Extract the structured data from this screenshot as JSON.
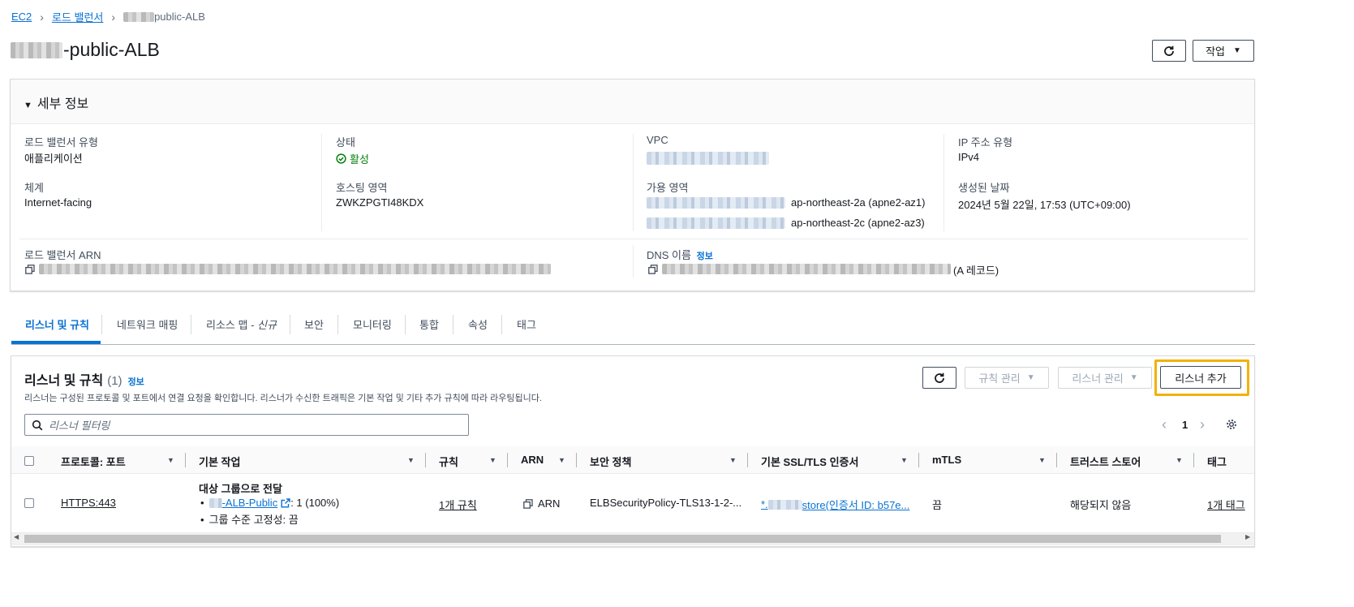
{
  "breadcrumb": {
    "items": [
      "EC2",
      "로드 밸런서"
    ],
    "current": "public-ALB"
  },
  "page": {
    "title": "-public-ALB"
  },
  "header_buttons": {
    "actions": "작업"
  },
  "details": {
    "section_title": "세부 정보",
    "lb_type_label": "로드 밸런서 유형",
    "lb_type_value": "애플리케이션",
    "scheme_label": "체계",
    "scheme_value": "Internet-facing",
    "state_label": "상태",
    "state_value": "활성",
    "hosted_zone_label": "호스팅 영역",
    "hosted_zone_value": "ZWKZPGTI48KDX",
    "vpc_label": "VPC",
    "az_label": "가용 영역",
    "az1": "ap-northeast-2a (apne2-az1)",
    "az2": "ap-northeast-2c (apne2-az3)",
    "ip_type_label": "IP 주소 유형",
    "ip_type_value": "IPv4",
    "created_label": "생성된 날짜",
    "created_value": "2024년 5월 22일, 17:53 (UTC+09:00)",
    "arn_label": "로드 밸런서 ARN",
    "dns_label": "DNS 이름",
    "dns_info": "정보",
    "dns_suffix": "(A 레코드)"
  },
  "tabs": [
    "리스너 및 규칙",
    "네트워크 매핑",
    "리소스 맵 - ",
    "보안",
    "모니터링",
    "통합",
    "속성",
    "태그"
  ],
  "tab_new": "신규",
  "listeners": {
    "title": "리스너 및 규칙",
    "count": "(1)",
    "info": "정보",
    "description": "리스너는 구성된 프로토콜 및 포트에서 연결 요청을 확인합니다. 리스너가 수신한 트래픽은 기본 작업 및 기타 추가 규칙에 따라 라우팅됩니다.",
    "manage_rules": "규칙 관리",
    "manage_listener": "리스너 관리",
    "add_listener": "리스너 추가",
    "filter_placeholder": "리스너 필터링",
    "page": "1",
    "columns": [
      "프로토콜: 포트",
      "기본 작업",
      "규칙",
      "ARN",
      "보안 정책",
      "기본 SSL/TLS 인증서",
      "mTLS",
      "트러스트 스토어",
      "태그"
    ],
    "row": {
      "protocol": "HTTPS:443",
      "action_title": "대상 그룹으로 전달",
      "target_group": "-ALB-Public",
      "target_weight": ": 1 (100%)",
      "stickiness": "그룹 수준 고정성: 끔",
      "rules": "1개 규칙",
      "arn": "ARN",
      "policy": "ELBSecurityPolicy-TLS13-1-2-...",
      "cert_prefix": "*.",
      "cert_rest": "store(인증서 ID: b57e...",
      "mtls": "끔",
      "trust_store": "해당되지 않음",
      "tags": "1개 태그"
    }
  },
  "colors": {
    "link": "#0972d3",
    "success": "#037f0c",
    "highlight": "#f2b10a"
  }
}
